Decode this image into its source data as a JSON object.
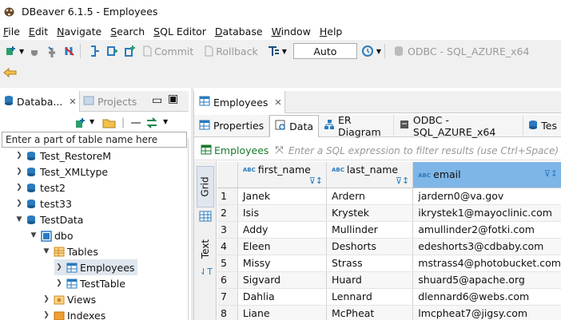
{
  "window": {
    "title": "DBeaver 6.1.5 - Employees"
  },
  "menu": [
    {
      "u": "F",
      "rest": "ile"
    },
    {
      "u": "E",
      "rest": "dit"
    },
    {
      "u": "N",
      "rest": "avigate"
    },
    {
      "u": "S",
      "rest": "earch"
    },
    {
      "u": "S",
      "rest": "QL Editor"
    },
    {
      "u": "D",
      "rest": "atabase"
    },
    {
      "u": "W",
      "rest": "indow"
    },
    {
      "u": "H",
      "rest": "elp"
    }
  ],
  "toolbar": {
    "commit": "Commit",
    "rollback": "Rollback",
    "mode": "Auto",
    "connection": "ODBC - SQL_AZURE_x64"
  },
  "left": {
    "tab_db": "Databa...",
    "tab_projects": "Projects",
    "filter_placeholder": "Enter a part of table name here",
    "tree": [
      {
        "label": "Test_RestoreM"
      },
      {
        "label": "Test_XMLtype"
      },
      {
        "label": "test2"
      },
      {
        "label": "test33"
      },
      {
        "label": "TestData"
      },
      {
        "label": "dbo"
      },
      {
        "label": "Tables"
      },
      {
        "label": "Employees"
      },
      {
        "label": "TestTable"
      },
      {
        "label": "Views"
      },
      {
        "label": "Indexes"
      }
    ]
  },
  "editor": {
    "tab": "Employees",
    "subtabs": [
      "Properties",
      "Data",
      "ER Diagram",
      "ODBC - SQL_AZURE_x64",
      "Tes"
    ],
    "filter_label": "Employees",
    "filter_placeholder": "Enter a SQL expression to filter results (use Ctrl+Space)",
    "vtab_grid": "Grid",
    "vtab_text": "Text",
    "columns": [
      "first_name",
      "last_name",
      "email"
    ],
    "rows": [
      [
        "1",
        "Janek",
        "Ardern",
        "jardern0@va.gov"
      ],
      [
        "2",
        "Isis",
        "Krystek",
        "ikrystek1@mayoclinic.com"
      ],
      [
        "3",
        "Addy",
        "Mullinder",
        "amullinder2@fotki.com"
      ],
      [
        "4",
        "Eleen",
        "Deshorts",
        "edeshorts3@cdbaby.com"
      ],
      [
        "5",
        "Missy",
        "Strass",
        "mstrass4@photobucket.com"
      ],
      [
        "6",
        "Sigvard",
        "Huard",
        "shuard5@apache.org"
      ],
      [
        "7",
        "Dahlia",
        "Lennard",
        "dlennard6@webs.com"
      ],
      [
        "8",
        "Liane",
        "McPheat",
        "lmcpheat7@jigsy.com"
      ]
    ]
  },
  "colors": {
    "accent": "#2a7abf",
    "selected_header": "#7eb6e8",
    "filter_green": "#1a7a2e"
  }
}
